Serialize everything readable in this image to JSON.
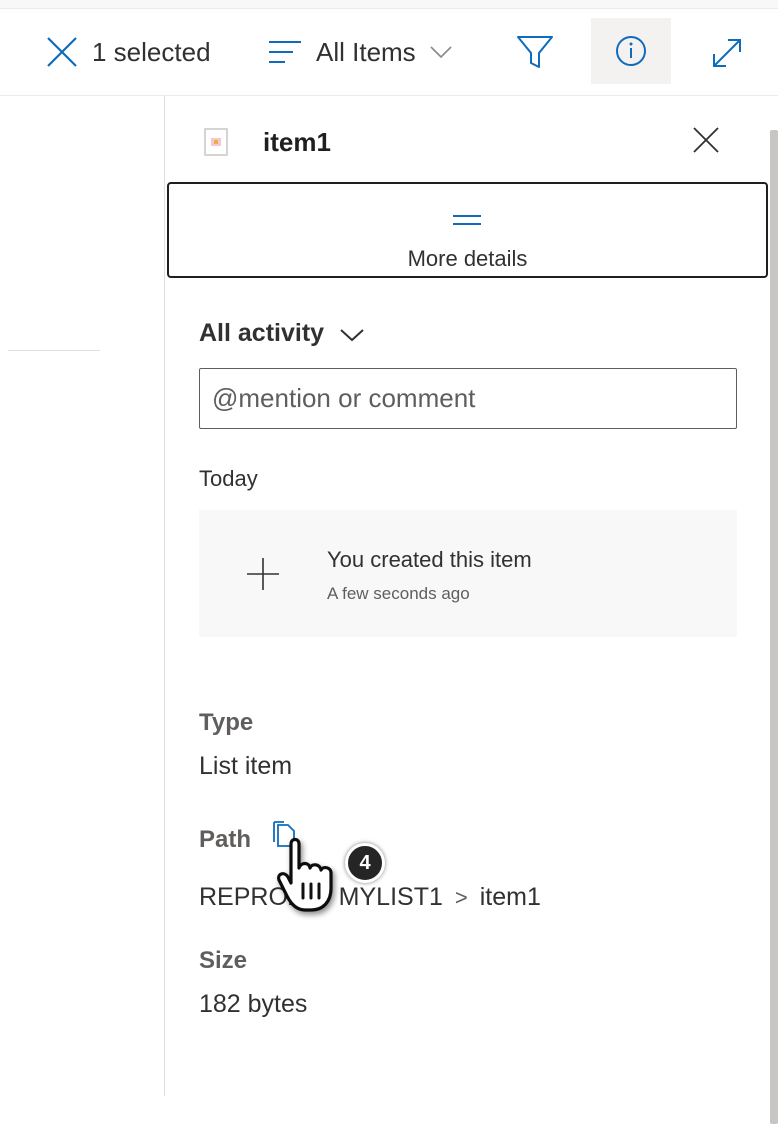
{
  "command_bar": {
    "selection_label": "1 selected",
    "view_label": "All Items",
    "icons": [
      "close-icon",
      "view-list-icon",
      "chevron-down-icon",
      "filter-icon",
      "info-icon",
      "expand-icon"
    ]
  },
  "details_panel": {
    "title": "item1",
    "more_details_label": "More details",
    "activity": {
      "header": "All activity",
      "comment_placeholder": "@mention or comment",
      "day_label": "Today",
      "items": [
        {
          "title": "You created this item",
          "time": "A few seconds ago"
        }
      ]
    },
    "properties": {
      "type_label": "Type",
      "type_value": "List item",
      "path_label": "Path",
      "path_crumbs": [
        "REPRO2",
        "MYLIST1",
        "item1"
      ],
      "size_label": "Size",
      "size_value": "182 bytes"
    }
  },
  "overlay": {
    "step_number": "4"
  },
  "colors": {
    "text": "#323130",
    "secondary_text": "#605e5c",
    "hover_bg": "#f3f2f1",
    "card_bg": "#f8f8f8"
  }
}
